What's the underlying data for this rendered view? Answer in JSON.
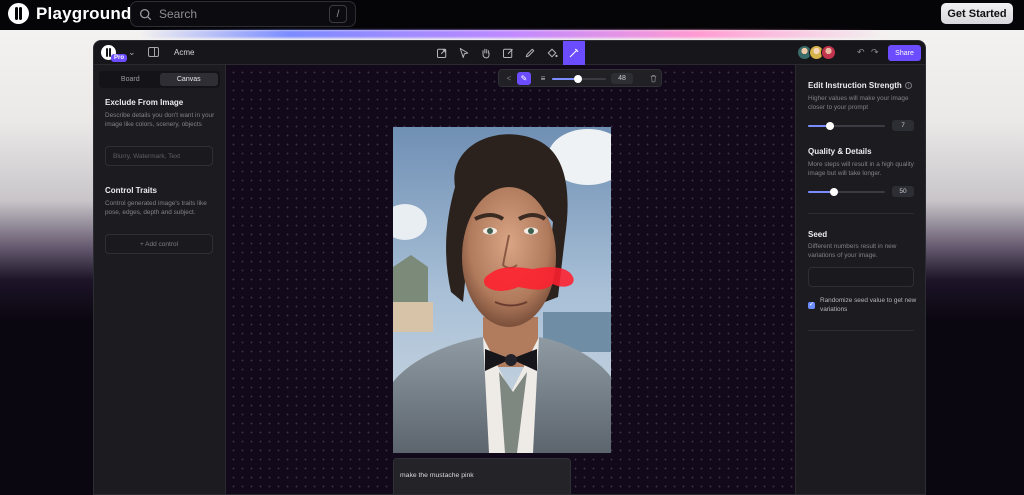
{
  "site": {
    "brand": "Playground",
    "search_placeholder": "Search",
    "search_shortcut": "/",
    "cta": "Get Started"
  },
  "toolbar": {
    "pro_badge": "Pro",
    "project_name": "Acme",
    "tools": [
      "import-icon",
      "select-icon",
      "hand-icon",
      "edit-image-icon",
      "pen-icon",
      "fill-icon",
      "brush-icon"
    ],
    "active_tool": "brush-icon",
    "share": "Share"
  },
  "left_panel": {
    "tabs": [
      {
        "label": "Board",
        "active": false
      },
      {
        "label": "Canvas",
        "active": true
      }
    ],
    "exclude_title": "Exclude From Image",
    "exclude_desc": "Describe details you don't want in your image like colors, scenery, objects",
    "exclude_placeholder": "Blurry, Watermark, Text",
    "control_title": "Control Traits",
    "control_desc": "Control generated image's traits like pose, edges, depth and subject.",
    "add_control": "+ Add control"
  },
  "brush_bar": {
    "size": 48,
    "size_max": 100
  },
  "canvas": {
    "prompt_text": "make the mustache pink"
  },
  "right_panel": {
    "strength_title": "Edit Instruction Strength",
    "strength_desc": "Higher values will make your image closer to your prompt",
    "strength_value": 7,
    "strength_max": 25,
    "quality_title": "Quality & Details",
    "quality_desc": "More steps will result in a high quality image but will take longer.",
    "quality_value": 50,
    "quality_max": 150,
    "seed_title": "Seed",
    "seed_desc": "Different numbers result in new variations of your image.",
    "seed_value": "",
    "randomize_label": "Randomize seed value to get new variations",
    "randomize_checked": true
  },
  "colors": {
    "accent": "#6b4cff",
    "slider": "#7b8cff",
    "mask": "#ff1f2e"
  }
}
